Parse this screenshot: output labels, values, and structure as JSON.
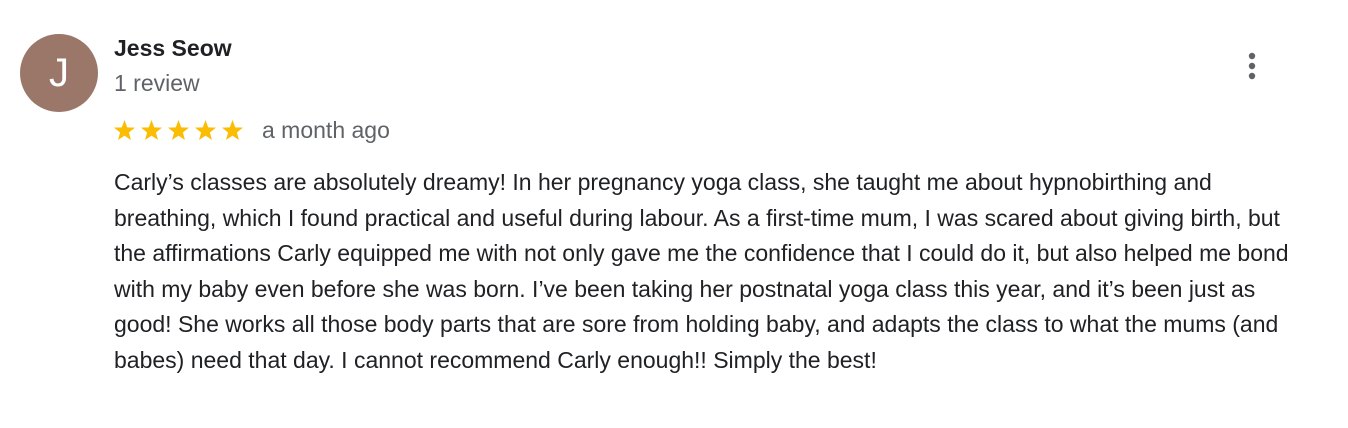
{
  "review": {
    "avatar_letter": "J",
    "author_name": "Jess Seow",
    "review_count": "1 review",
    "rating": 5,
    "rating_max": 5,
    "time_ago": "a month ago",
    "text": "Carly’s classes are absolutely dreamy! In her pregnancy yoga class, she taught me about hypnobirthing and breathing, which I found practical and useful during labour. As a first-time mum, I was scared about giving birth, but the affirmations Carly equipped me with not only gave me the confidence that I could do it, but also helped me bond with my baby even before she was born. I’ve been taking her postnatal yoga class this year, and it’s been just as good! She works all those body parts that are sore from holding baby, and adapts the class to what the mums (and babes) need that day. I cannot recommend Carly enough!! Simply the best!"
  },
  "icons": {
    "star": "star-icon",
    "menu": "more-vert-icon"
  },
  "colors": {
    "avatar_bg": "#9b776a",
    "star": "#fbbc04",
    "primary_text": "#202124",
    "secondary_text": "#5f6368"
  }
}
